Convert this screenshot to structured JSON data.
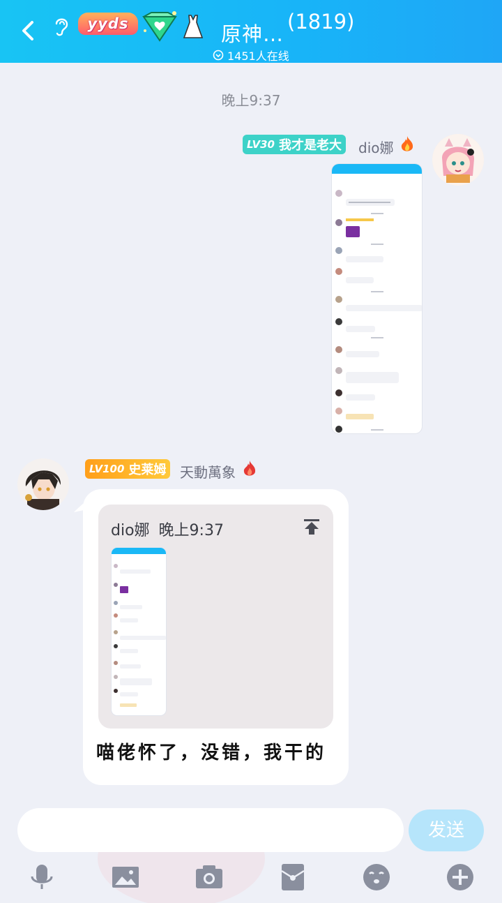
{
  "header": {
    "badge_text": "yyds",
    "group_title": "原神…",
    "member_count": "(1819)",
    "online_text": "1451人在线",
    "accent_color": "#18b4f8",
    "icons": [
      "back-icon",
      "ear-icon",
      "yyds-badge",
      "diamond-badge-icon",
      "dress-icon",
      "online-status-icon"
    ]
  },
  "chat": {
    "timestamp": "晚上9:37",
    "messages": [
      {
        "side": "right",
        "level": "LV30",
        "title": "我才是老大",
        "title_color": "#3dd2c8",
        "nickname": "dio娜",
        "content": "image"
      },
      {
        "side": "left",
        "level": "LV100",
        "title": "史莱姆",
        "title_color": "#ffb020",
        "nickname": "天動萬象",
        "quote": {
          "author": "dio娜",
          "time": "晚上9:37"
        },
        "text": "喵佬怀了，没错，我干的"
      }
    ]
  },
  "composer": {
    "input_placeholder": "",
    "send_label": "发送",
    "toolbar": [
      "microphone-icon",
      "image-icon",
      "camera-icon",
      "red-packet-icon",
      "emoji-icon",
      "plus-icon"
    ]
  }
}
